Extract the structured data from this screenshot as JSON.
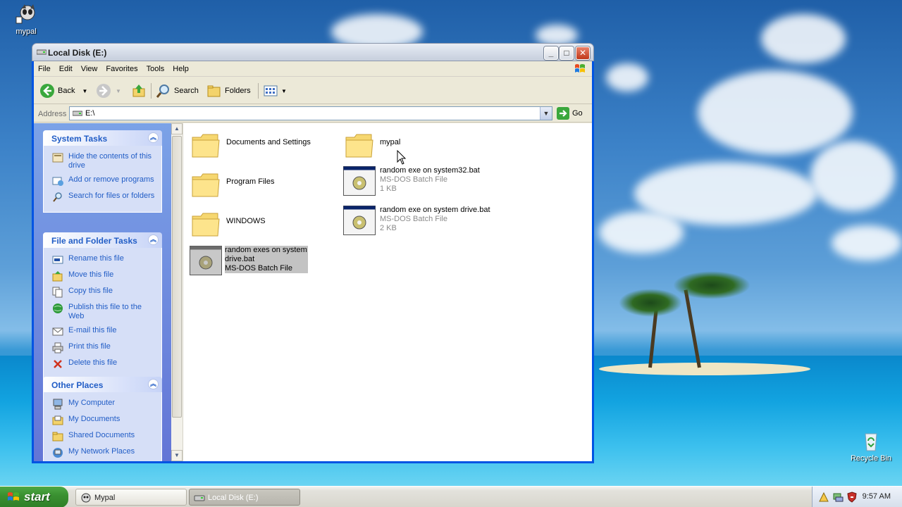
{
  "desktop": {
    "icons": [
      {
        "label": "mypal"
      },
      {
        "label": "Recycle Bin"
      }
    ]
  },
  "window": {
    "title": "Local Disk (E:)",
    "controls": {
      "minimize": "_",
      "maximize": "□",
      "close": "✕"
    }
  },
  "menu": {
    "items": [
      "File",
      "Edit",
      "View",
      "Favorites",
      "Tools",
      "Help"
    ]
  },
  "toolbar": {
    "back_label": "Back",
    "search_label": "Search",
    "folders_label": "Folders"
  },
  "address": {
    "label": "Address",
    "value": "E:\\",
    "go_label": "Go"
  },
  "taskpane": {
    "system_tasks": {
      "title": "System Tasks",
      "links": [
        "Hide the contents of this drive",
        "Add or remove programs",
        "Search for files or folders"
      ]
    },
    "file_folder_tasks": {
      "title": "File and Folder Tasks",
      "links": [
        "Rename this file",
        "Move this file",
        "Copy this file",
        "Publish this file to the Web",
        "E-mail this file",
        "Print this file",
        "Delete this file"
      ]
    },
    "other_places": {
      "title": "Other Places",
      "links": [
        "My Computer",
        "My Documents",
        "Shared Documents",
        "My Network Places"
      ]
    }
  },
  "files": [
    {
      "name": "Documents and Settings",
      "type": "",
      "size": "",
      "kind": "folder"
    },
    {
      "name": "mypal",
      "type": "",
      "size": "",
      "kind": "folder"
    },
    {
      "name": "Program Files",
      "type": "",
      "size": "",
      "kind": "folder"
    },
    {
      "name": "random exe on system32.bat",
      "type": "MS-DOS Batch File",
      "size": "1 KB",
      "kind": "bat"
    },
    {
      "name": "WINDOWS",
      "type": "",
      "size": "",
      "kind": "folder"
    },
    {
      "name": "random exe on system drive.bat",
      "type": "MS-DOS Batch File",
      "size": "2 KB",
      "kind": "bat"
    },
    {
      "name": "random exes on system drive.bat",
      "type": "MS-DOS Batch File",
      "size": "",
      "kind": "bat",
      "selected": true
    }
  ],
  "taskbar": {
    "start_label": "start",
    "tasks": [
      "Mypal",
      "Local Disk (E:)"
    ],
    "clock": "9:57 AM"
  },
  "colors": {
    "xp_blue": "#0054e3",
    "link_blue": "#215dc6",
    "start_green": "#3a9131"
  }
}
